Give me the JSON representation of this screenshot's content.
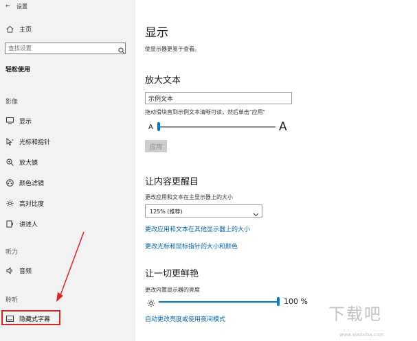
{
  "window": {
    "title": "设置"
  },
  "sidebar": {
    "home_label": "主页",
    "search_placeholder": "查找设置",
    "category_title": "轻松使用",
    "sections": {
      "vision": "影像",
      "hearing": "听力",
      "interaction": "聆听"
    },
    "items": [
      {
        "label": "显示",
        "icon": "monitor-icon"
      },
      {
        "label": "光标和指针",
        "icon": "pointer-icon"
      },
      {
        "label": "放大镜",
        "icon": "magnifier-icon"
      },
      {
        "label": "颜色滤镜",
        "icon": "color-filter-icon"
      },
      {
        "label": "高对比度",
        "icon": "sun-icon"
      },
      {
        "label": "讲述人",
        "icon": "narrator-icon"
      },
      {
        "label": "音频",
        "icon": "speaker-icon"
      },
      {
        "label": "隐藏式字幕",
        "icon": "captions-icon"
      }
    ],
    "highlight_color": "#e02020"
  },
  "main": {
    "title": "显示",
    "subtitle": "使显示器更易于查看。",
    "enlarge_text": {
      "heading": "放大文本",
      "sample_value": "示例文本",
      "instruction": "拖动滑块直到示例文本清晰可读，然后单击\"应用\"",
      "small_a": "A",
      "large_a": "A",
      "apply_label": "应用",
      "slider_level": 0.0
    },
    "make_prominent": {
      "heading": "让内容更醒目",
      "scale_label": "更改应用和文本在主显示器上的大小",
      "scale_value": "125% (推荐)",
      "link_other_displays": "更改应用和文本在其他显示器上的大小",
      "link_pointer": "更改光标和鼠标指针的大小和颜色"
    },
    "brighter": {
      "heading": "让一切更鲜艳",
      "brightness_label": "更改内置显示器的亮度",
      "brightness_value": "100 %",
      "brightness_level": 1.0,
      "link_auto": "自动更改亮度或使用夜间模式"
    }
  },
  "watermark": {
    "text": "下载吧",
    "url": "www.xiazaiba.com"
  },
  "colors": {
    "accent": "#0078d7",
    "link": "#0063b1",
    "sidebar_bg": "#f2f2f2"
  }
}
